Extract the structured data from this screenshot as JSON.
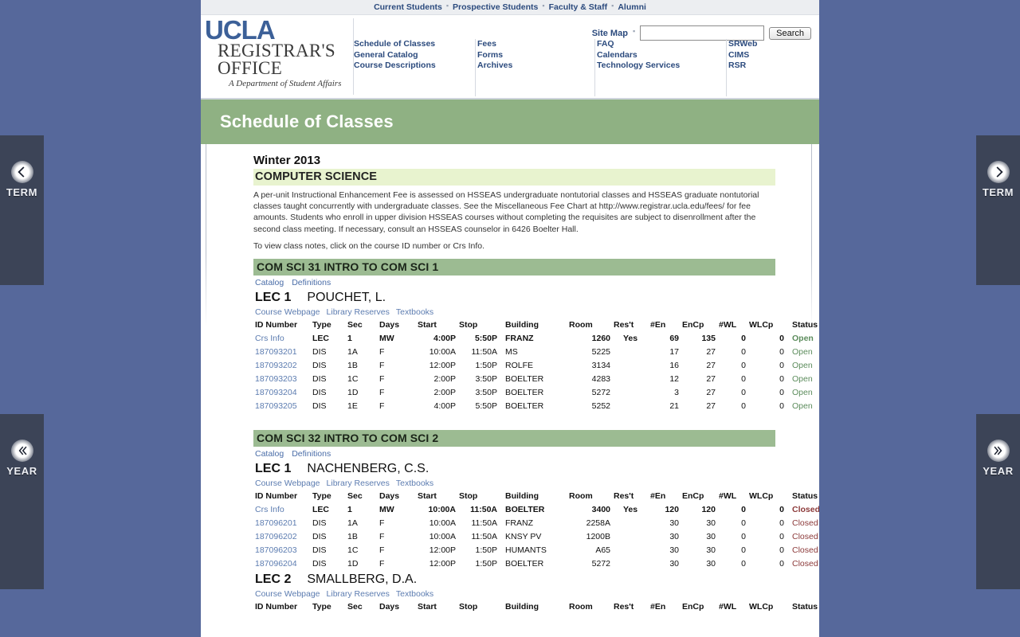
{
  "audience_nav": {
    "items": [
      {
        "label": "Current Students"
      },
      {
        "label": "Prospective Students"
      },
      {
        "label": "Faculty & Staff"
      },
      {
        "label": "Alumni"
      }
    ],
    "separator": "▪"
  },
  "brand": {
    "ucla": "UCLA",
    "line1": "REGISTRAR'S",
    "line2": "OFFICE",
    "tagline": "A Department of Student Affairs"
  },
  "search": {
    "sitemap_label": "Site Map",
    "separator": "▪",
    "value": "",
    "placeholder": "",
    "button_label": "Search"
  },
  "main_nav": {
    "columns": [
      {
        "items": [
          "Schedule of Classes",
          "General Catalog",
          "Course Descriptions"
        ]
      },
      {
        "items": [
          "Fees",
          "Forms",
          "Archives"
        ]
      },
      {
        "items": [
          "FAQ",
          "Calendars",
          "Technology Services"
        ]
      },
      {
        "items": [
          "SRWeb",
          "CIMS",
          "RSR"
        ]
      }
    ]
  },
  "page_banner": {
    "title": "Schedule of Classes",
    "band_color": "#8fb183"
  },
  "content": {
    "term": "Winter 2013",
    "department": "COMPUTER SCIENCE",
    "notices": [
      "A per-unit Instructional Enhancement Fee is assessed on HSSEAS undergraduate nontutorial classes and HSSEAS graduate nontutorial classes taught concurrently with undergraduate classes. See the Miscellaneous Fee Chart at http://www.registrar.ucla.edu/fees/ for fee amounts. Students who enroll in upper division HSSEAS courses without completing the requisites are subject to disenrollment after the second class meeting. If necessary, consult an HSSEAS counselor in 6426 Boelter Hall.",
      "To view class notes, click on the course ID number or Crs Info."
    ]
  },
  "table_headers": {
    "id": "ID Number",
    "type": "Type",
    "sec": "Sec",
    "days": "Days",
    "start": "Start",
    "stop": "Stop",
    "building": "Building",
    "room": "Room",
    "rest": "Res't",
    "en": "#En",
    "encp": "EnCp",
    "wl": "#WL",
    "wlcp": "WLCp",
    "status": "Status"
  },
  "link_labels": {
    "catalog": "Catalog",
    "definitions": "Definitions",
    "course_webpage": "Course Webpage",
    "library_reserves": "Library Reserves",
    "textbooks": "Textbooks",
    "crs_info": "Crs Info"
  },
  "courses": [
    {
      "bar_title": "COM SCI 31 INTRO TO COM SCI 1",
      "lectures": [
        {
          "lec_label": "LEC 1",
          "instructor": "POUCHET, L.",
          "rows": [
            {
              "id": "Crs Info",
              "id_is_link": true,
              "bold": true,
              "type": "LEC",
              "sec": "1",
              "days": "MW",
              "start": "4:00P",
              "stop": "5:50P",
              "building": "FRANZ",
              "room": "1260",
              "rest": "Yes",
              "en": "69",
              "encp": "135",
              "wl": "0",
              "wlcp": "0",
              "status": "Open",
              "status_kind": "open"
            },
            {
              "id": "187093201",
              "id_is_link": true,
              "bold": false,
              "type": "DIS",
              "sec": "1A",
              "days": "F",
              "start": "10:00A",
              "stop": "11:50A",
              "building": "MS",
              "room": "5225",
              "rest": "",
              "en": "17",
              "encp": "27",
              "wl": "0",
              "wlcp": "0",
              "status": "Open",
              "status_kind": "open"
            },
            {
              "id": "187093202",
              "id_is_link": true,
              "bold": false,
              "type": "DIS",
              "sec": "1B",
              "days": "F",
              "start": "12:00P",
              "stop": "1:50P",
              "building": "ROLFE",
              "room": "3134",
              "rest": "",
              "en": "16",
              "encp": "27",
              "wl": "0",
              "wlcp": "0",
              "status": "Open",
              "status_kind": "open"
            },
            {
              "id": "187093203",
              "id_is_link": true,
              "bold": false,
              "type": "DIS",
              "sec": "1C",
              "days": "F",
              "start": "2:00P",
              "stop": "3:50P",
              "building": "BOELTER",
              "room": "4283",
              "rest": "",
              "en": "12",
              "encp": "27",
              "wl": "0",
              "wlcp": "0",
              "status": "Open",
              "status_kind": "open"
            },
            {
              "id": "187093204",
              "id_is_link": true,
              "bold": false,
              "type": "DIS",
              "sec": "1D",
              "days": "F",
              "start": "2:00P",
              "stop": "3:50P",
              "building": "BOELTER",
              "room": "5272",
              "rest": "",
              "en": "3",
              "encp": "27",
              "wl": "0",
              "wlcp": "0",
              "status": "Open",
              "status_kind": "open"
            },
            {
              "id": "187093205",
              "id_is_link": true,
              "bold": false,
              "type": "DIS",
              "sec": "1E",
              "days": "F",
              "start": "4:00P",
              "stop": "5:50P",
              "building": "BOELTER",
              "room": "5252",
              "rest": "",
              "en": "21",
              "encp": "27",
              "wl": "0",
              "wlcp": "0",
              "status": "Open",
              "status_kind": "open"
            }
          ]
        }
      ]
    },
    {
      "bar_title": "COM SCI 32 INTRO TO COM SCI 2",
      "lectures": [
        {
          "lec_label": "LEC 1",
          "instructor": "NACHENBERG, C.S.",
          "rows": [
            {
              "id": "Crs Info",
              "id_is_link": true,
              "bold": true,
              "type": "LEC",
              "sec": "1",
              "days": "MW",
              "start": "10:00A",
              "stop": "11:50A",
              "building": "BOELTER",
              "room": "3400",
              "rest": "Yes",
              "en": "120",
              "encp": "120",
              "wl": "0",
              "wlcp": "0",
              "status": "Closed",
              "status_kind": "closed"
            },
            {
              "id": "187096201",
              "id_is_link": true,
              "bold": false,
              "type": "DIS",
              "sec": "1A",
              "days": "F",
              "start": "10:00A",
              "stop": "11:50A",
              "building": "FRANZ",
              "room": "2258A",
              "rest": "",
              "en": "30",
              "encp": "30",
              "wl": "0",
              "wlcp": "0",
              "status": "Closed",
              "status_kind": "closed"
            },
            {
              "id": "187096202",
              "id_is_link": true,
              "bold": false,
              "type": "DIS",
              "sec": "1B",
              "days": "F",
              "start": "10:00A",
              "stop": "11:50A",
              "building": "KNSY PV",
              "room": "1200B",
              "rest": "",
              "en": "30",
              "encp": "30",
              "wl": "0",
              "wlcp": "0",
              "status": "Closed",
              "status_kind": "closed"
            },
            {
              "id": "187096203",
              "id_is_link": true,
              "bold": false,
              "type": "DIS",
              "sec": "1C",
              "days": "F",
              "start": "12:00P",
              "stop": "1:50P",
              "building": "HUMANTS",
              "room": "A65",
              "rest": "",
              "en": "30",
              "encp": "30",
              "wl": "0",
              "wlcp": "0",
              "status": "Closed",
              "status_kind": "closed"
            },
            {
              "id": "187096204",
              "id_is_link": true,
              "bold": false,
              "type": "DIS",
              "sec": "1D",
              "days": "F",
              "start": "12:00P",
              "stop": "1:50P",
              "building": "BOELTER",
              "room": "5272",
              "rest": "",
              "en": "30",
              "encp": "30",
              "wl": "0",
              "wlcp": "0",
              "status": "Closed",
              "status_kind": "closed"
            }
          ]
        },
        {
          "lec_label": "LEC 2",
          "instructor": "SMALLBERG, D.A.",
          "rows": []
        }
      ]
    }
  ],
  "rails": [
    {
      "id": "term-prev",
      "label": "TERM",
      "icon": "chevron-left-icon",
      "side": "left",
      "group": "term"
    },
    {
      "id": "term-next",
      "label": "TERM",
      "icon": "chevron-right-icon",
      "side": "right",
      "group": "term"
    },
    {
      "id": "year-prev",
      "label": "YEAR",
      "icon": "double-chevron-left-icon",
      "side": "left",
      "group": "year"
    },
    {
      "id": "year-next",
      "label": "YEAR",
      "icon": "double-chevron-right-icon",
      "side": "right",
      "group": "year"
    }
  ]
}
